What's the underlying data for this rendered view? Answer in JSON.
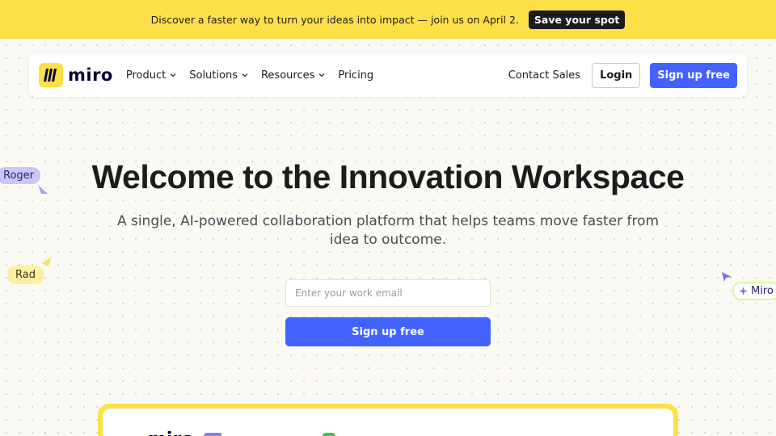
{
  "banner": {
    "text": "Discover a faster way to turn your ideas into impact — join us on April 2.",
    "button": "Save your spot"
  },
  "nav": {
    "logo_text": "miro",
    "items": [
      {
        "label": "Product",
        "has_dropdown": true
      },
      {
        "label": "Solutions",
        "has_dropdown": true
      },
      {
        "label": "Resources",
        "has_dropdown": true
      },
      {
        "label": "Pricing",
        "has_dropdown": false
      }
    ],
    "contact": "Contact Sales",
    "login": "Login",
    "signup": "Sign up free"
  },
  "hero": {
    "title": "Welcome to the Innovation Workspace",
    "subtitle": "A single, AI-powered collaboration platform that helps teams move faster from idea to outcome.",
    "email_placeholder": "Enter your work email",
    "email_value": "",
    "signup": "Sign up free"
  },
  "cursors": [
    {
      "name": "Roger",
      "color": "#c9c6f8"
    },
    {
      "name": "Rad",
      "color": "#fdf0a0"
    },
    {
      "name": "Miro",
      "color": "#d9f99d"
    }
  ],
  "colors": {
    "banner": "#fde047",
    "accent": "#4262ff",
    "page": "#fbf9f4"
  }
}
